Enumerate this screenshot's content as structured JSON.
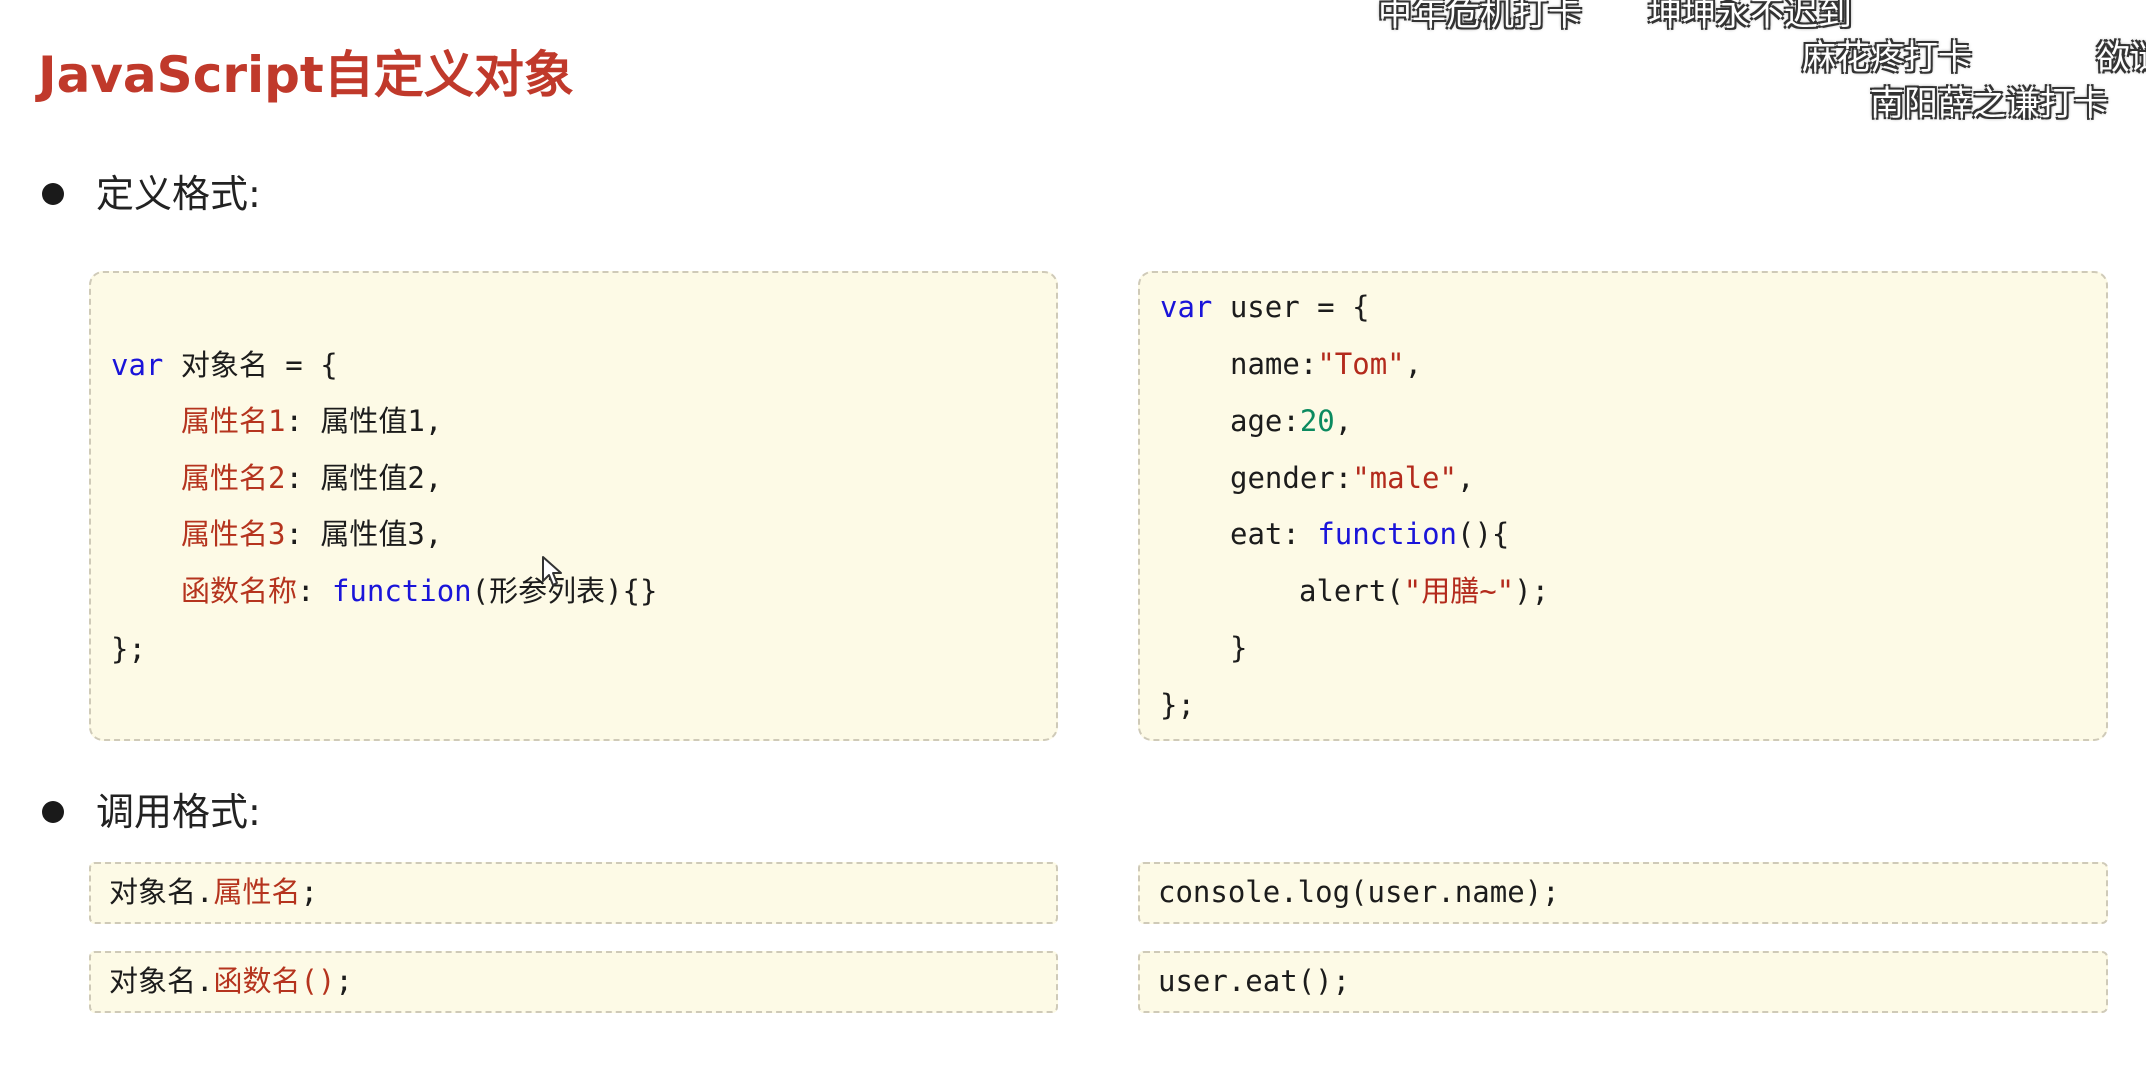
{
  "title": "JavaScript自定义对象",
  "sections": {
    "define": "定义格式:",
    "call": "调用格式:"
  },
  "template_code": {
    "line1_kw": "var",
    "line1_rest": " 对象名 = {",
    "line2_prop": "属性名1",
    "line2_rest": ": 属性值1,",
    "line3_prop": "属性名2",
    "line3_rest": ": 属性值2,",
    "line4_prop": "属性名3",
    "line4_rest": ": 属性值3,",
    "line5_prop": "函数名称",
    "line5_sep": ": ",
    "line5_kw": "function",
    "line5_rest": "(形参列表){}",
    "line6": "};"
  },
  "example_code": {
    "line1_kw": "var",
    "line1_rest": " user = {",
    "line2_key": "name:",
    "line2_val": "\"Tom\"",
    "line2_end": ",",
    "line3_key": "age:",
    "line3_val": "20",
    "line3_end": ",",
    "line4_key": "gender:",
    "line4_val": "\"male\"",
    "line4_end": ",",
    "line5_key": "eat: ",
    "line5_kw": "function",
    "line5_rest": "(){",
    "line6_pre": "alert(",
    "line6_str": "\"用膳~\"",
    "line6_end": ");",
    "line7": "}",
    "line8": "};"
  },
  "call_template": {
    "prop_prefix": "对象名.",
    "prop_name": "属性名",
    "prop_end": ";",
    "func_prefix": "对象名.",
    "func_name": "函数名()",
    "func_end": ";"
  },
  "call_example": {
    "prop": "console.log(user.name);",
    "func": "user.eat();"
  },
  "danmaku": [
    "中年危机打卡",
    "坤坤永不迟到",
    "麻花疼打卡",
    "欲谜",
    "南阳薛之谦打卡"
  ],
  "colors": {
    "title": "#c0392b",
    "keyword": "#1a14d9",
    "property": "#b5341e",
    "string": "#b32a1c",
    "number": "#0b8a5f",
    "box_bg": "#fdfae6"
  }
}
